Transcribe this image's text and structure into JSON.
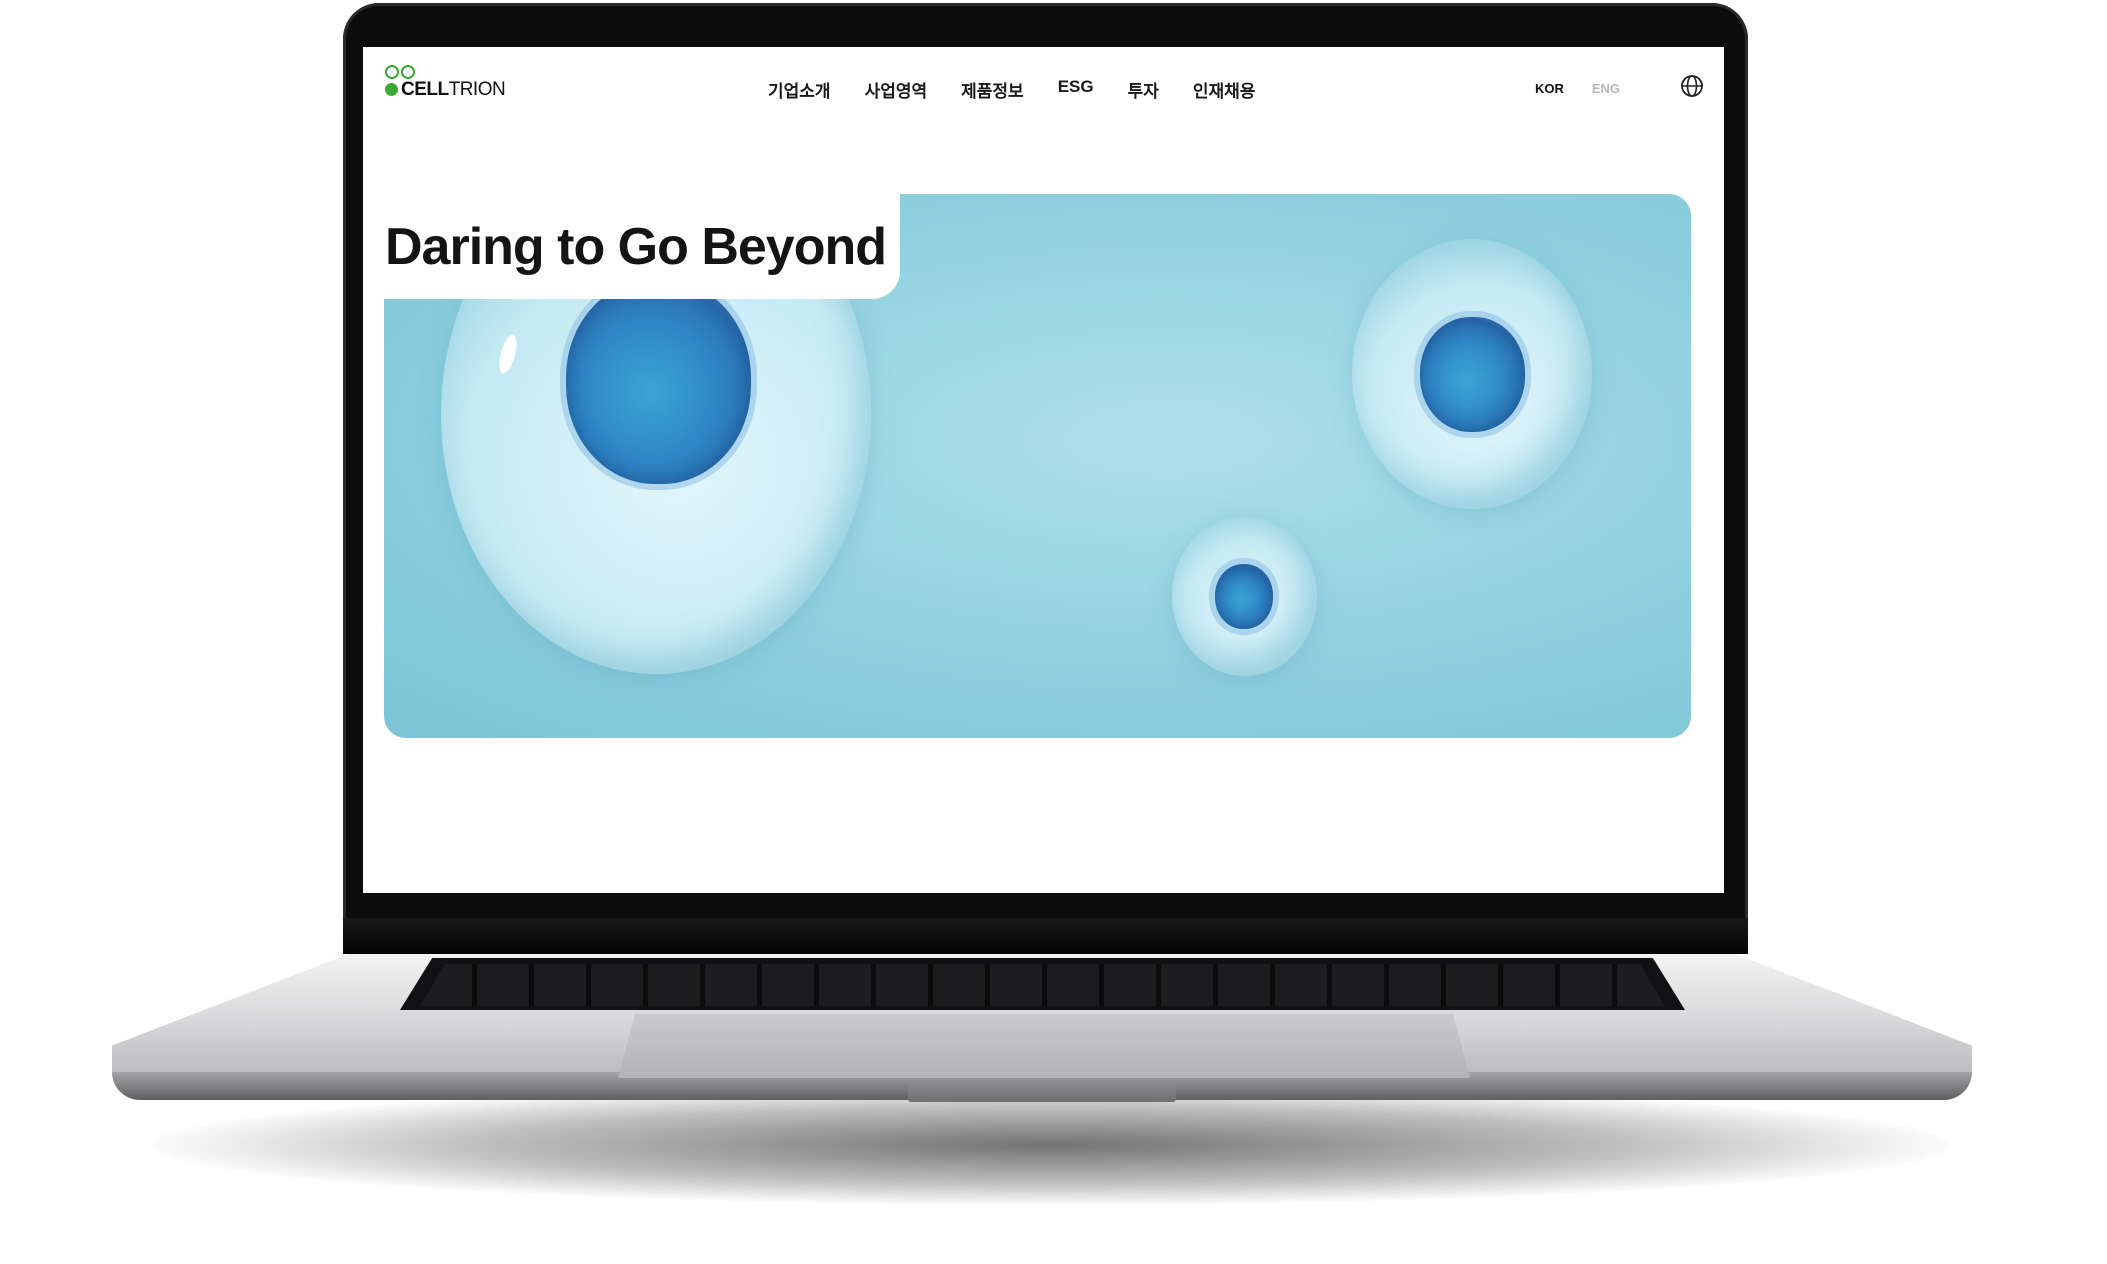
{
  "brand": {
    "logo_bold": "CELL",
    "logo_regular": "TRION",
    "accent_color": "#3aa935"
  },
  "nav": {
    "items": [
      {
        "label": "기업소개"
      },
      {
        "label": "사업영역"
      },
      {
        "label": "제품정보"
      },
      {
        "label": "ESG"
      },
      {
        "label": "투자"
      },
      {
        "label": "인재채용"
      }
    ],
    "lang_kor": "KOR",
    "lang_eng": "ENG",
    "globe_icon": "globe-icon"
  },
  "hero": {
    "title": "Daring to Go Beyond",
    "image": "blue-cells-illustration"
  }
}
